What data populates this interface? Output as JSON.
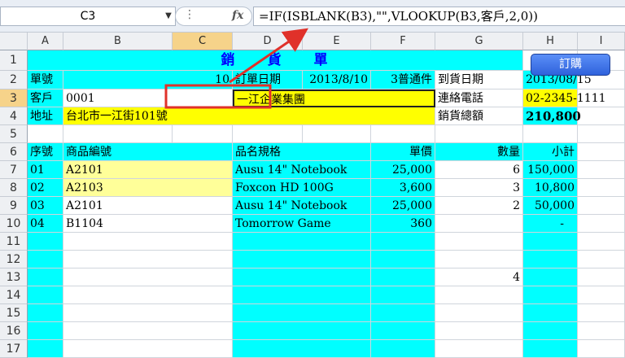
{
  "formula_bar": {
    "name_box": "C3",
    "fx_label": "fx",
    "formula": "=IF(ISBLANK(B3),\"\",VLOOKUP(B3,客戶,2,0))"
  },
  "columns": [
    "A",
    "B",
    "C",
    "D",
    "E",
    "F",
    "G",
    "H",
    "I"
  ],
  "rows": [
    "1",
    "2",
    "3",
    "4",
    "5",
    "6",
    "7",
    "8",
    "9",
    "10",
    "11",
    "12",
    "13",
    "14",
    "15",
    "16",
    "17"
  ],
  "sheet": {
    "title": "銷　　貨　　單",
    "order_no_label": "單號",
    "order_no": "10",
    "order_date_label": "訂單日期",
    "order_date": "2013/8/10",
    "payment_terms": "3普通件",
    "arrival_date_label": "到貨日期",
    "arrival_date": "2013/08/15",
    "customer_label": "客戶",
    "customer_id": "0001",
    "customer_name": "一江企業集團",
    "phone_label": "連絡電話",
    "phone": "02-2345-1111",
    "address_label": "地址",
    "address": "台北市一江街101號",
    "total_label": "銷貨總額",
    "total": "210,800"
  },
  "table": {
    "headers": {
      "seq": "序號",
      "product_no": "商品編號",
      "spec": "品名規格",
      "price": "單價",
      "qty": "數量",
      "subtotal": "小計"
    },
    "items": [
      {
        "seq": "01",
        "product_no": "A2101",
        "spec": "Ausu 14\" Notebook",
        "price": "25,000",
        "qty": "6",
        "subtotal": "150,000"
      },
      {
        "seq": "02",
        "product_no": "A2103",
        "spec": "Foxcon HD 100G",
        "price": "3,600",
        "qty": "3",
        "subtotal": "10,800"
      },
      {
        "seq": "03",
        "product_no": "A2101",
        "spec": "Ausu 14\" Notebook",
        "price": "25,000",
        "qty": "2",
        "subtotal": "50,000"
      },
      {
        "seq": "04",
        "product_no": "B1104",
        "spec": "Tomorrow Game",
        "price": "360",
        "qty": "",
        "subtotal": "-"
      }
    ],
    "stray_qty_row13": "4"
  },
  "order_button": "訂購",
  "colors": {
    "cyan": "#00ffff",
    "yellow": "#ffff00",
    "light_yellow": "#ffff99",
    "title_blue": "#0000ff",
    "arrow_red": "#e0312a",
    "selection": "#f6d38a"
  }
}
